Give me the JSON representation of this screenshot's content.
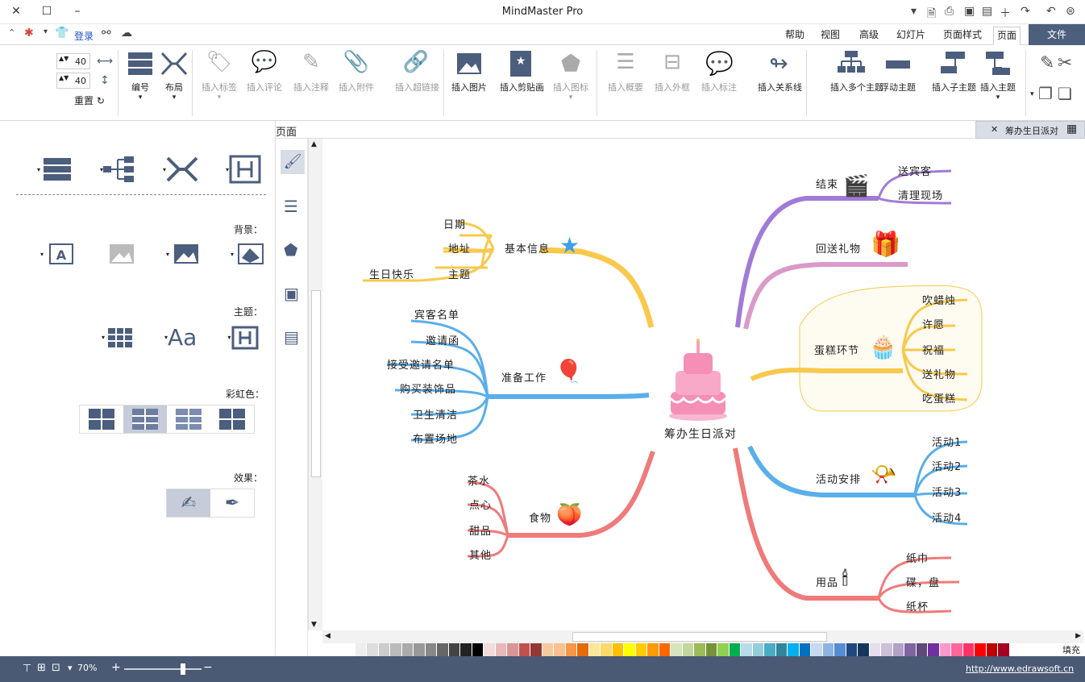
{
  "app": {
    "title": "MindMaster Pro"
  },
  "quick_access": {
    "login": "登录"
  },
  "menu": {
    "file": "文件",
    "tabs": [
      "页面",
      "页面样式",
      "幻灯片",
      "高级",
      "视图",
      "帮助"
    ]
  },
  "ribbon": {
    "clipboard": {},
    "buttons_right": [
      "插入主题",
      "插入子主题",
      "浮动主题",
      "插入多个主题"
    ],
    "buttons_mid": [
      "插入关系线",
      "插入标注",
      "插入外框",
      "插入概要"
    ],
    "buttons_insert": [
      "插入图标",
      "插入剪贴画",
      "插入图片"
    ],
    "buttons_disabled": [
      "插入超链接",
      "插入附件",
      "插入注释",
      "插入评论",
      "插入标签"
    ],
    "layout": "布局",
    "numbering": "编号",
    "reset": "重置",
    "spin1": "40",
    "spin2": "40"
  },
  "pane": {
    "title": "页面"
  },
  "doc_tab": {
    "label": "筹办生日派对"
  },
  "left_panel": {
    "background_label": "背景：",
    "theme_label": "主题：",
    "rainbow_label": "彩虹色：",
    "effect_label": "效果："
  },
  "mindmap": {
    "center": "筹办生日派对",
    "branches": {
      "basic": {
        "label": "基本信息",
        "children": [
          "日期",
          "地址",
          "主题"
        ],
        "grandchild": "生日快乐"
      },
      "prep": {
        "label": "准备工作",
        "children": [
          "宾客名单",
          "邀请函",
          "接受邀请名单",
          "购买装饰品",
          "卫生清洁",
          "布置场地"
        ]
      },
      "food": {
        "label": "食物",
        "children": [
          "茶水",
          "点心",
          "甜品",
          "其他"
        ]
      },
      "end": {
        "label": "结束",
        "children": [
          "送宾客",
          "清理现场"
        ]
      },
      "gift": {
        "label": "回送礼物"
      },
      "cake": {
        "label": "蛋糕环节",
        "children": [
          "吹蜡烛",
          "许愿",
          "祝福",
          "送礼物",
          "吃蛋糕"
        ]
      },
      "activity": {
        "label": "活动安排",
        "children": [
          "活动1",
          "活动2",
          "活动3",
          "活动4"
        ]
      },
      "supplies": {
        "label": "用品",
        "children": [
          "纸巾",
          "碟，盘",
          "纸杯"
        ]
      }
    }
  },
  "status": {
    "zoom": "70%",
    "url": "http://www.edrawsoft.cn",
    "fill": "填充"
  },
  "colors": {
    "accent": "#4c607e",
    "yellow": "#f8c94c",
    "blue": "#5aaeea",
    "red": "#f07a7a",
    "purple": "#a27bd6",
    "pink": "#d99ac9"
  }
}
